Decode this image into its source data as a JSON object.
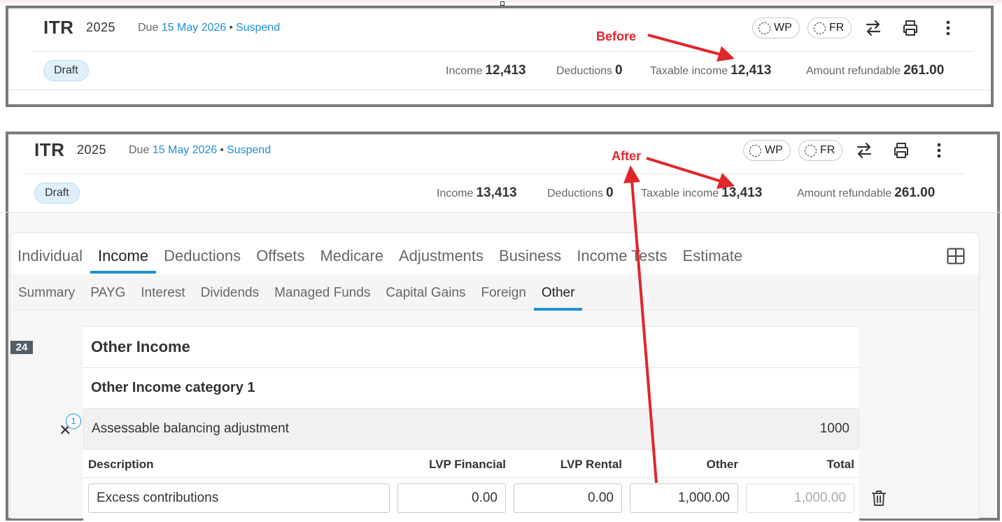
{
  "before": {
    "title": "ITR",
    "year": "2025",
    "due_label": "Due",
    "due_date": "15 May 2026",
    "suspend": "Suspend",
    "wp": "WP",
    "fr": "FR",
    "status": "Draft",
    "income_label": "Income",
    "income_value": "12,413",
    "deductions_label": "Deductions",
    "deductions_value": "0",
    "taxable_label": "Taxable income",
    "taxable_value": "12,413",
    "refund_label": "Amount refundable",
    "refund_value": "261.00",
    "annotation": "Before"
  },
  "after": {
    "title": "ITR",
    "year": "2025",
    "due_label": "Due",
    "due_date": "15 May 2026",
    "suspend": "Suspend",
    "wp": "WP",
    "fr": "FR",
    "status": "Draft",
    "income_label": "Income",
    "income_value": "13,413",
    "deductions_label": "Deductions",
    "deductions_value": "0",
    "taxable_label": "Taxable income",
    "taxable_value": "13,413",
    "refund_label": "Amount refundable",
    "refund_value": "261.00",
    "annotation": "After",
    "tabs": [
      "Individual",
      "Income",
      "Deductions",
      "Offsets",
      "Medicare",
      "Adjustments",
      "Business",
      "Income Tests",
      "Estimate"
    ],
    "active_tab": "Income",
    "subtabs": [
      "Summary",
      "PAYG",
      "Interest",
      "Dividends",
      "Managed Funds",
      "Capital Gains",
      "Foreign",
      "Other"
    ],
    "active_subtab": "Other",
    "section_number": "24",
    "section_title": "Other Income",
    "category_title": "Other Income category 1",
    "category_row": {
      "label": "Assessable balancing adjustment",
      "amount": "1000",
      "count": "1"
    },
    "columns": [
      "Description",
      "LVP Financial",
      "LVP Rental",
      "Other",
      "Total"
    ],
    "row": {
      "description": "Excess contributions",
      "lvp_financial": "0.00",
      "lvp_rental": "0.00",
      "other": "1,000.00",
      "total": "1,000.00"
    }
  },
  "colors": {
    "accent": "#1f8fd6",
    "annotation": "#e0262b",
    "frame": "#7a7a7a",
    "draft_bg": "#dff0fb"
  },
  "icons": [
    "dashed-circle-icon",
    "swap-arrows-icon",
    "printer-icon",
    "more-vertical-icon",
    "grid-layout-icon",
    "close-icon",
    "trash-icon"
  ]
}
